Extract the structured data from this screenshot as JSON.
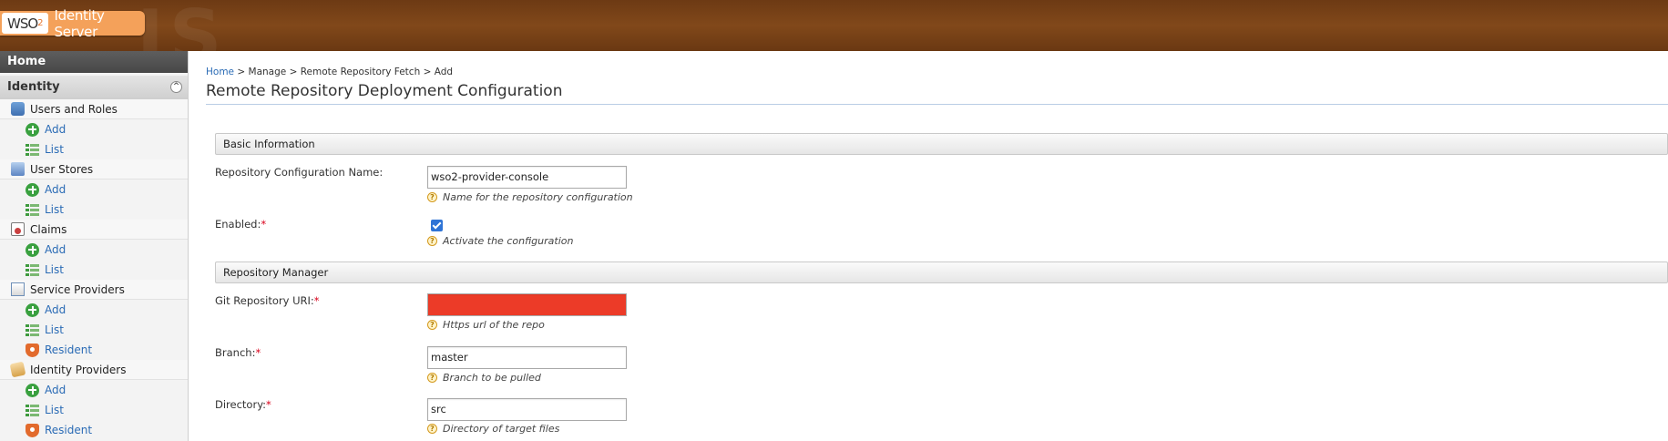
{
  "header": {
    "logo_wso": "WSO",
    "logo_two": "2",
    "product_name": "Identity Server",
    "watermark": "IS"
  },
  "sidebar": {
    "home_label": "Home",
    "section_label": "Identity",
    "collapse_glyph": "^",
    "groups": [
      {
        "label": "Users and Roles",
        "icon": "users-roles-icon",
        "items": [
          {
            "label": "Add"
          },
          {
            "label": "List"
          }
        ]
      },
      {
        "label": "User Stores",
        "icon": "user-stores-icon",
        "items": [
          {
            "label": "Add"
          },
          {
            "label": "List"
          }
        ]
      },
      {
        "label": "Claims",
        "icon": "claims-icon",
        "items": [
          {
            "label": "Add"
          },
          {
            "label": "List"
          }
        ]
      },
      {
        "label": "Service Providers",
        "icon": "service-providers-icon",
        "items": [
          {
            "label": "Add"
          },
          {
            "label": "List"
          },
          {
            "label": "Resident"
          }
        ]
      },
      {
        "label": "Identity Providers",
        "icon": "identity-providers-icon",
        "items": [
          {
            "label": "Add"
          },
          {
            "label": "List"
          },
          {
            "label": "Resident"
          }
        ]
      }
    ]
  },
  "main": {
    "breadcrumb": {
      "home": "Home",
      "sep": ">",
      "manage": "Manage",
      "fetch": "Remote Repository Fetch",
      "current": "Add"
    },
    "page_title": "Remote Repository Deployment Configuration",
    "sections": {
      "basic_information": "Basic Information",
      "repository_manager": "Repository Manager"
    },
    "fields": {
      "config_name": {
        "label": "Repository Configuration Name:",
        "value": "wso2-provider-console",
        "hint": "Name for the repository configuration"
      },
      "enabled": {
        "label": "Enabled:",
        "required_mark": "*",
        "checked": true,
        "hint": "Activate the configuration"
      },
      "git_uri": {
        "label": "Git Repository URI:",
        "required_mark": "*",
        "value": "",
        "hint": "Https url of the repo"
      },
      "branch": {
        "label": "Branch:",
        "required_mark": "*",
        "value": "master",
        "hint": "Branch to be pulled"
      },
      "directory": {
        "label": "Directory:",
        "required_mark": "*",
        "value": "src",
        "hint": "Directory of target files"
      }
    },
    "help_glyph": "?"
  },
  "colors": {
    "header_brown": "#81481a",
    "logo_orange": "#f4a15a",
    "link_blue": "#2a6bb5",
    "required_red": "#d9001b",
    "redacted_red": "#ec3b28"
  }
}
